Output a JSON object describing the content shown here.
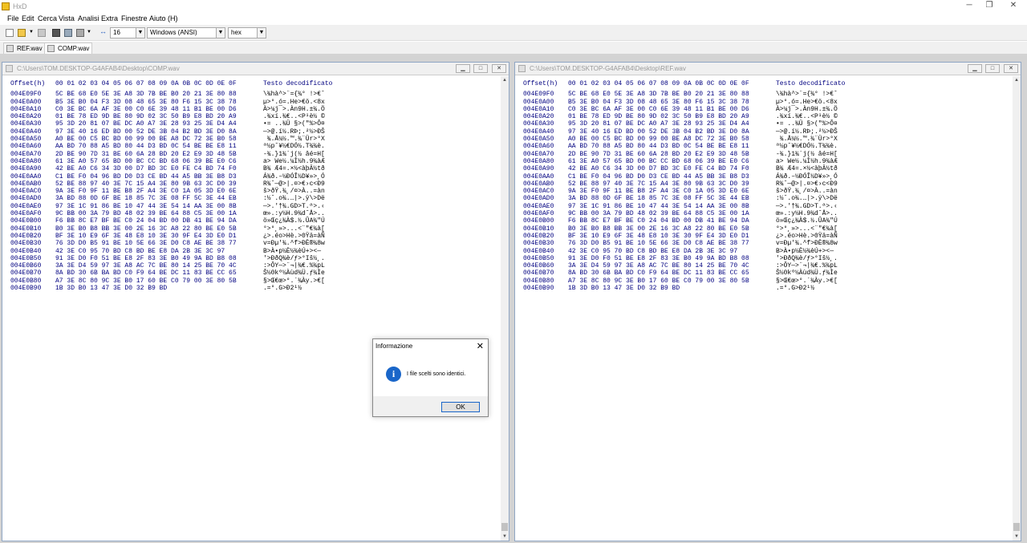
{
  "app": {
    "title": "HxD"
  },
  "menu": [
    "File",
    "Edit",
    "Cerca",
    "Vista",
    "Analisi",
    "Extra",
    "Finestre",
    "Aiuto (H)"
  ],
  "toolbar": {
    "bytes_per_row": "16",
    "charset": "Windows (ANSI)",
    "offset_base": "hex"
  },
  "tabs": [
    {
      "label": "REF.wav"
    },
    {
      "label": "COMP.wav"
    }
  ],
  "panes": [
    {
      "title": "C:\\Users\\TOM.DESKTOP-G4AFAB4\\Desktop\\COMP.wav"
    },
    {
      "title": "C:\\Users\\TOM.DESKTOP-G4AFAB4\\Desktop\\REF.wav"
    }
  ],
  "hex_header": {
    "offset": "Offset(h)",
    "columns": "00 01 02 03 04 05 06 07 08 09 0A 0B 0C 0D 0E 0F",
    "decoded": "Testo decodificato"
  },
  "rows": [
    {
      "offset": "004E09F0",
      "bytes": "5C BE 68 E0 5E 3E A8 3D 7B BE B0 20 21 3E 80 88",
      "text": "\\¾hà^>¨={¾° !>€ˆ"
    },
    {
      "offset": "004E0A00",
      "bytes": "B5 3E B0 04 F3 3D 08 48 65 3E 80 F6 15 3C 38 78",
      "text": "µ>°.ó=.He>€ö.<8x"
    },
    {
      "offset": "004E0A10",
      "bytes": "C0 3E BC 6A AF 3E 00 C0 6E 39 48 11 B1 BE 00 D6",
      "text": "À>¼j¯>.Àn9H.±¾.Ö"
    },
    {
      "offset": "004E0A20",
      "bytes": "01 BE 78 ED 9D BE 80 9D 02 3C 50 B9 E8 BD 20 A9",
      "text": ".¾xí.¾€..<P¹è½ ©"
    },
    {
      "offset": "004E0A30",
      "bytes": "95 3D 20 81 07 BE DC A0 A7 3E 28 93 25 3E D4 A4",
      "text": "•= ..¾Ü §>(\"%>Ô¤"
    },
    {
      "offset": "004E0A40",
      "bytes": "97 3E 40 16 ED BD 00 52 DE 3B 04 B2 BD 3E D0 8A",
      "text": "—>@.í½.RÞ;.²½>ÐŠ"
    },
    {
      "offset": "004E0A50",
      "bytes": "A0 BE 00 C5 BC BD 00 99 00 BE A8 DC 72 3E B0 58",
      "text": " ¾.Å¼½.™.¾¨Ür>°X"
    },
    {
      "offset": "004E0A60",
      "bytes": "AA BD 70 88 A5 BD 80 44 D3 BD 0C 54 BE BE E8 11",
      "text": "ª½pˆ¥½€DÓ½.T¾¾è."
    },
    {
      "offset": "004E0A70",
      "bytes": "2D BE 90 7D 31 BE 60 6A 28 BD 20 E2 E9 3D 48 5B",
      "text": "-¾.}1¾`j(½ âé=H["
    },
    {
      "offset": "004E0A80",
      "bytes": "61 3E A0 57 65 BD 00 BC CC BD 68 06 39 BE E0 C6",
      "text": "a> We½.¼Ì½h.9¾àÆ"
    },
    {
      "offset": "004E0A90",
      "bytes": "42 BE A0 C6 34 3D 00 D7 BD 3C E0 FE C4 BD 74 F0",
      "text": "B¾ Æ4=.×½<àþÄ½tð"
    },
    {
      "offset": "004E0AA0",
      "bytes": "C1 BE F0 04 96 BD D0 D3 CE BD 44 A5 BB 3E B8 D3",
      "text": "Á¾ð.–½ÐÓÎ½D¥»>¸Ó"
    },
    {
      "offset": "004E0AB0",
      "bytes": "52 BE 88 97 40 3E 7C 15 A4 3E 80 9B 63 3C D0 39",
      "text": "R¾ˆ—@>|.¤>€›c<Ð9"
    },
    {
      "offset": "004E0AC0",
      "bytes": "9A 3E F0 9F 11 BE B8 2F A4 3E C0 1A 05 3D E0 6E",
      "text": "š>ðŸ.¾¸/¤>À..=àn"
    },
    {
      "offset": "004E0AD0",
      "bytes": "3A BD 88 0D 6F BE 18 85 7C 3E 08 FF 5C 3E 44 EB",
      "text": ":½ˆ.o¾.…|>.ÿ\\>Dë"
    },
    {
      "offset": "004E0AE0",
      "bytes": "97 3E 1C 91 86 BE 10 47 44 3E 54 14 AA 3E 00 8B",
      "text": "—>.'†¾.GD>T.ª>.‹"
    },
    {
      "offset": "004E0AF0",
      "bytes": "9C BB 00 3A 79 BD 48 02 39 BE 64 88 C5 3E 00 1A",
      "text": "œ».:y½H.9¾dˆÅ>.."
    },
    {
      "offset": "004E0B00",
      "bytes": "F6 BB 8C E7 BF BE C0 24 04 BD 00 DB 41 BE 94 DA",
      "text": "ö»Œç¿¾À$.½.ÛA¾\"Ú"
    },
    {
      "offset": "004E0B10",
      "bytes": "B0 3E B0 B8 BB 3E 00 2E 16 3C A8 22 80 BE E0 5B",
      "text": "°>°¸»>...<¨\"€¾à["
    },
    {
      "offset": "004E0B20",
      "bytes": "BF 3E 10 E9 6F 3E 48 E8 10 3E 30 9F E4 3D E0 D1",
      "text": "¿>.éo>Hè.>0Ÿä=àÑ"
    },
    {
      "offset": "004E0B30",
      "bytes": "76 3D D0 B5 91 BE 10 5E 66 3E D0 C8 AE BE 38 77",
      "text": "v=Ðµ'¾.^f>ÐÈ®¾8w"
    },
    {
      "offset": "004E0B40",
      "bytes": "42 3E C0 95 70 BD C8 BD BE E8 DA 2B 3E 3C 97",
      "text": "B>À•p½È½¾èÚ+><—"
    },
    {
      "offset": "004E0B50",
      "bytes": "91 3E D0 F0 51 BE E8 2F 83 3E B0 49 9A BD B8 08",
      "text": "'>ÐðQ¾è/ƒ>°Iš½¸."
    },
    {
      "offset": "004E0B60",
      "bytes": "3A 3E D4 59 97 3E A8 AC 7C BE 80 14 25 BE 70 4C",
      "text": ":>ÔY—>¨¬|¾€.%¾pL"
    },
    {
      "offset": "004E0B70",
      "bytes": "8A BD 30 6B BA BD C0 F9 64 BE DC 11 83 BE CC 65",
      "text": "Š½0kº½Àùd¾Ü.ƒ¾Ìe"
    },
    {
      "offset": "004E0B80",
      "bytes": "A7 3E 8C 80 9C 3E B0 17 60 BE C0 79 00 3E 80 5B",
      "text": "§>Œ€œ>°.`¾Ày.>€["
    },
    {
      "offset": "004E0B90",
      "bytes": "1B 3D B0 13 47 3E D0 32 B9 BD",
      "text": ".=°.G>Ð2¹½"
    }
  ],
  "dialog": {
    "title": "Informazione",
    "message": "I file scelti sono identici.",
    "ok": "OK"
  }
}
